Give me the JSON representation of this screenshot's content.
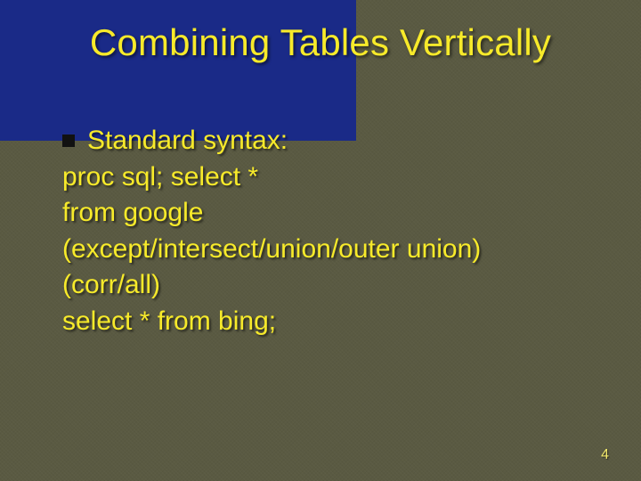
{
  "slide": {
    "title": "Combining Tables Vertically",
    "bullet_first": "Standard syntax:",
    "lines": {
      "l1": "proc sql;  select *",
      "l2": "from google",
      "l3": "(except/intersect/union/outer union)",
      "l4": "(corr/all)",
      "l5": "select * from bing;"
    },
    "page_number": "4"
  }
}
